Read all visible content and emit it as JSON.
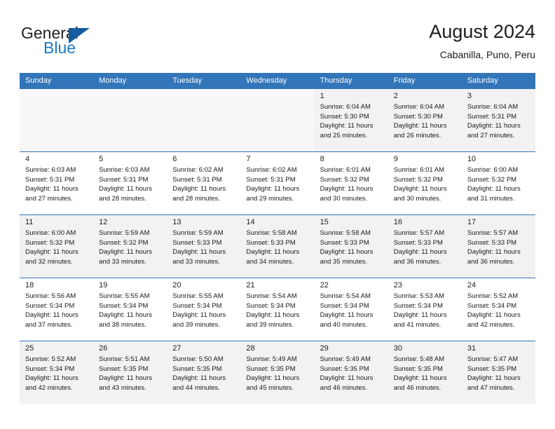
{
  "brand": {
    "name_part1": "General",
    "name_part2": "Blue",
    "logo_icon": "triangle-logo-icon"
  },
  "header": {
    "title": "August 2024",
    "location": "Cabanilla, Puno, Peru"
  },
  "colors": {
    "header_blue": "#3275b9",
    "brand_blue": "#1c7bc2",
    "logo_blue": "#145c9e",
    "shaded_row": "#f2f2f2",
    "blank_cell": "#f7f7f7"
  },
  "weekdays": [
    "Sunday",
    "Monday",
    "Tuesday",
    "Wednesday",
    "Thursday",
    "Friday",
    "Saturday"
  ],
  "labels": {
    "sunrise_prefix": "Sunrise:",
    "sunset_prefix": "Sunset:",
    "daylight_prefix": "Daylight:"
  },
  "weeks": [
    [
      {
        "day": "",
        "empty": true
      },
      {
        "day": "",
        "empty": true
      },
      {
        "day": "",
        "empty": true
      },
      {
        "day": "",
        "empty": true
      },
      {
        "day": "1",
        "sunrise": "Sunrise: 6:04 AM",
        "sunset": "Sunset: 5:30 PM",
        "daylight1": "Daylight: 11 hours",
        "daylight2": "and 25 minutes."
      },
      {
        "day": "2",
        "sunrise": "Sunrise: 6:04 AM",
        "sunset": "Sunset: 5:30 PM",
        "daylight1": "Daylight: 11 hours",
        "daylight2": "and 26 minutes."
      },
      {
        "day": "3",
        "sunrise": "Sunrise: 6:04 AM",
        "sunset": "Sunset: 5:31 PM",
        "daylight1": "Daylight: 11 hours",
        "daylight2": "and 27 minutes."
      }
    ],
    [
      {
        "day": "4",
        "sunrise": "Sunrise: 6:03 AM",
        "sunset": "Sunset: 5:31 PM",
        "daylight1": "Daylight: 11 hours",
        "daylight2": "and 27 minutes."
      },
      {
        "day": "5",
        "sunrise": "Sunrise: 6:03 AM",
        "sunset": "Sunset: 5:31 PM",
        "daylight1": "Daylight: 11 hours",
        "daylight2": "and 28 minutes."
      },
      {
        "day": "6",
        "sunrise": "Sunrise: 6:02 AM",
        "sunset": "Sunset: 5:31 PM",
        "daylight1": "Daylight: 11 hours",
        "daylight2": "and 28 minutes."
      },
      {
        "day": "7",
        "sunrise": "Sunrise: 6:02 AM",
        "sunset": "Sunset: 5:31 PM",
        "daylight1": "Daylight: 11 hours",
        "daylight2": "and 29 minutes."
      },
      {
        "day": "8",
        "sunrise": "Sunrise: 6:01 AM",
        "sunset": "Sunset: 5:32 PM",
        "daylight1": "Daylight: 11 hours",
        "daylight2": "and 30 minutes."
      },
      {
        "day": "9",
        "sunrise": "Sunrise: 6:01 AM",
        "sunset": "Sunset: 5:32 PM",
        "daylight1": "Daylight: 11 hours",
        "daylight2": "and 30 minutes."
      },
      {
        "day": "10",
        "sunrise": "Sunrise: 6:00 AM",
        "sunset": "Sunset: 5:32 PM",
        "daylight1": "Daylight: 11 hours",
        "daylight2": "and 31 minutes."
      }
    ],
    [
      {
        "day": "11",
        "sunrise": "Sunrise: 6:00 AM",
        "sunset": "Sunset: 5:32 PM",
        "daylight1": "Daylight: 11 hours",
        "daylight2": "and 32 minutes."
      },
      {
        "day": "12",
        "sunrise": "Sunrise: 5:59 AM",
        "sunset": "Sunset: 5:32 PM",
        "daylight1": "Daylight: 11 hours",
        "daylight2": "and 33 minutes."
      },
      {
        "day": "13",
        "sunrise": "Sunrise: 5:59 AM",
        "sunset": "Sunset: 5:33 PM",
        "daylight1": "Daylight: 11 hours",
        "daylight2": "and 33 minutes."
      },
      {
        "day": "14",
        "sunrise": "Sunrise: 5:58 AM",
        "sunset": "Sunset: 5:33 PM",
        "daylight1": "Daylight: 11 hours",
        "daylight2": "and 34 minutes."
      },
      {
        "day": "15",
        "sunrise": "Sunrise: 5:58 AM",
        "sunset": "Sunset: 5:33 PM",
        "daylight1": "Daylight: 11 hours",
        "daylight2": "and 35 minutes."
      },
      {
        "day": "16",
        "sunrise": "Sunrise: 5:57 AM",
        "sunset": "Sunset: 5:33 PM",
        "daylight1": "Daylight: 11 hours",
        "daylight2": "and 36 minutes."
      },
      {
        "day": "17",
        "sunrise": "Sunrise: 5:57 AM",
        "sunset": "Sunset: 5:33 PM",
        "daylight1": "Daylight: 11 hours",
        "daylight2": "and 36 minutes."
      }
    ],
    [
      {
        "day": "18",
        "sunrise": "Sunrise: 5:56 AM",
        "sunset": "Sunset: 5:34 PM",
        "daylight1": "Daylight: 11 hours",
        "daylight2": "and 37 minutes."
      },
      {
        "day": "19",
        "sunrise": "Sunrise: 5:55 AM",
        "sunset": "Sunset: 5:34 PM",
        "daylight1": "Daylight: 11 hours",
        "daylight2": "and 38 minutes."
      },
      {
        "day": "20",
        "sunrise": "Sunrise: 5:55 AM",
        "sunset": "Sunset: 5:34 PM",
        "daylight1": "Daylight: 11 hours",
        "daylight2": "and 39 minutes."
      },
      {
        "day": "21",
        "sunrise": "Sunrise: 5:54 AM",
        "sunset": "Sunset: 5:34 PM",
        "daylight1": "Daylight: 11 hours",
        "daylight2": "and 39 minutes."
      },
      {
        "day": "22",
        "sunrise": "Sunrise: 5:54 AM",
        "sunset": "Sunset: 5:34 PM",
        "daylight1": "Daylight: 11 hours",
        "daylight2": "and 40 minutes."
      },
      {
        "day": "23",
        "sunrise": "Sunrise: 5:53 AM",
        "sunset": "Sunset: 5:34 PM",
        "daylight1": "Daylight: 11 hours",
        "daylight2": "and 41 minutes."
      },
      {
        "day": "24",
        "sunrise": "Sunrise: 5:52 AM",
        "sunset": "Sunset: 5:34 PM",
        "daylight1": "Daylight: 11 hours",
        "daylight2": "and 42 minutes."
      }
    ],
    [
      {
        "day": "25",
        "sunrise": "Sunrise: 5:52 AM",
        "sunset": "Sunset: 5:34 PM",
        "daylight1": "Daylight: 11 hours",
        "daylight2": "and 42 minutes."
      },
      {
        "day": "26",
        "sunrise": "Sunrise: 5:51 AM",
        "sunset": "Sunset: 5:35 PM",
        "daylight1": "Daylight: 11 hours",
        "daylight2": "and 43 minutes."
      },
      {
        "day": "27",
        "sunrise": "Sunrise: 5:50 AM",
        "sunset": "Sunset: 5:35 PM",
        "daylight1": "Daylight: 11 hours",
        "daylight2": "and 44 minutes."
      },
      {
        "day": "28",
        "sunrise": "Sunrise: 5:49 AM",
        "sunset": "Sunset: 5:35 PM",
        "daylight1": "Daylight: 11 hours",
        "daylight2": "and 45 minutes."
      },
      {
        "day": "29",
        "sunrise": "Sunrise: 5:49 AM",
        "sunset": "Sunset: 5:35 PM",
        "daylight1": "Daylight: 11 hours",
        "daylight2": "and 46 minutes."
      },
      {
        "day": "30",
        "sunrise": "Sunrise: 5:48 AM",
        "sunset": "Sunset: 5:35 PM",
        "daylight1": "Daylight: 11 hours",
        "daylight2": "and 46 minutes."
      },
      {
        "day": "31",
        "sunrise": "Sunrise: 5:47 AM",
        "sunset": "Sunset: 5:35 PM",
        "daylight1": "Daylight: 11 hours",
        "daylight2": "and 47 minutes."
      }
    ]
  ]
}
